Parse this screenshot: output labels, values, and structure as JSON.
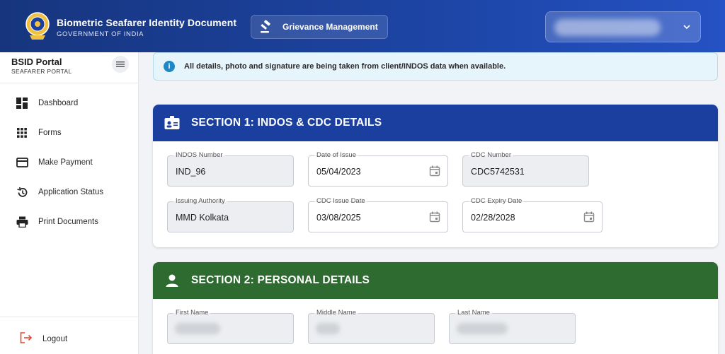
{
  "header": {
    "title": "Biometric Seafarer Identity Document",
    "subtitle": "GOVERNMENT OF INDIA",
    "grievance_label": "Grievance Management",
    "colors": {
      "bg": "#1d45a5"
    }
  },
  "sidebar": {
    "title": "BSID Portal",
    "subtitle": "SEAFARER PORTAL",
    "items": [
      {
        "label": "Dashboard",
        "icon": "dashboard-icon"
      },
      {
        "label": "Forms",
        "icon": "grid-icon"
      },
      {
        "label": "Make Payment",
        "icon": "credit-card-icon"
      },
      {
        "label": "Application Status",
        "icon": "history-icon"
      },
      {
        "label": "Print Documents",
        "icon": "printer-icon"
      }
    ],
    "logout_label": "Logout"
  },
  "banner": {
    "text": "All details, photo and signature are being taken from client/INDOS data when available."
  },
  "section1": {
    "title": "SECTION 1: INDOS & CDC DETAILS",
    "fields": {
      "indos_number": {
        "label": "INDOS Number",
        "value": "IND_96"
      },
      "date_of_issue": {
        "label": "Date of Issue",
        "value": "05/04/2023"
      },
      "cdc_number": {
        "label": "CDC Number",
        "value": "CDC5742531"
      },
      "issuing_authority": {
        "label": "Issuing Authority",
        "value": "MMD Kolkata"
      },
      "cdc_issue_date": {
        "label": "CDC Issue Date",
        "value": "03/08/2025"
      },
      "cdc_expiry_date": {
        "label": "CDC Expiry Date",
        "value": "02/28/2028"
      }
    },
    "color": "#1b3f9e"
  },
  "section2": {
    "title": "SECTION 2: PERSONAL DETAILS",
    "fields": {
      "first_name": {
        "label": "First Name"
      },
      "middle_name": {
        "label": "Middle Name"
      },
      "last_name": {
        "label": "Last Name"
      }
    },
    "color": "#2e6b30"
  }
}
